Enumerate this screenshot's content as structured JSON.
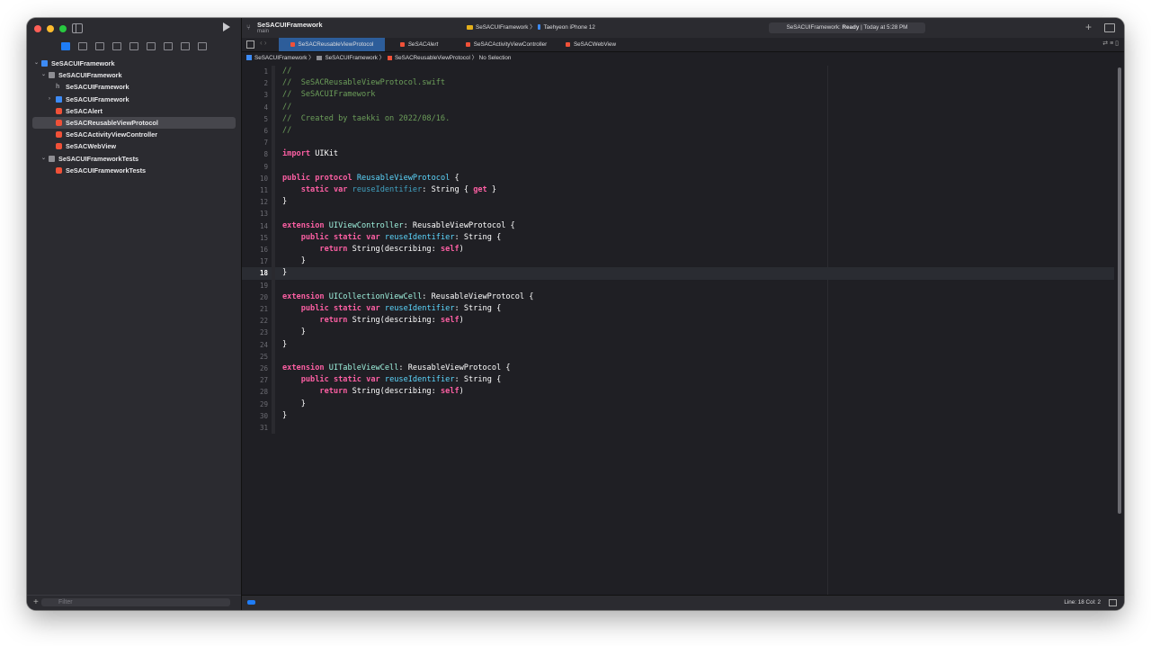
{
  "window": {
    "project_name": "SeSACUIFramework",
    "branch": "main"
  },
  "toolbar": {
    "scheme_target": "SeSACUIFramework",
    "scheme_device": "Taehyeon iPhone 12",
    "status_project": "SeSACUIFramework: ",
    "status_state": "Ready",
    "status_time": " | Today at 5:28 PM"
  },
  "navigator": {
    "items": [
      {
        "label": "SeSACUIFramework",
        "indent": 0,
        "icon": "proj",
        "chev": "⌄"
      },
      {
        "label": "SeSACUIFramework",
        "indent": 1,
        "icon": "folder",
        "chev": "⌄"
      },
      {
        "label": "SeSACUIFramework",
        "indent": 2,
        "icon": "hfile",
        "chev": ""
      },
      {
        "label": "SeSACUIFramework",
        "indent": 2,
        "icon": "proj",
        "chev": "›"
      },
      {
        "label": "SeSACAlert",
        "indent": 2,
        "icon": "swift",
        "chev": ""
      },
      {
        "label": "SeSACReusableViewProtocol",
        "indent": 2,
        "icon": "swift",
        "chev": "",
        "selected": true
      },
      {
        "label": "SeSACActivityViewController",
        "indent": 2,
        "icon": "swift",
        "chev": ""
      },
      {
        "label": "SeSACWebView",
        "indent": 2,
        "icon": "swift",
        "chev": ""
      },
      {
        "label": "SeSACUIFrameworkTests",
        "indent": 1,
        "icon": "folder",
        "chev": "⌄"
      },
      {
        "label": "SeSACUIFrameworkTests",
        "indent": 2,
        "icon": "swift",
        "chev": ""
      }
    ],
    "filter_placeholder": "Filter"
  },
  "tabs": [
    {
      "label": "SeSACReusableViewProtocol",
      "active": true
    },
    {
      "label": "SeSACAlert",
      "active": false
    },
    {
      "label": "SeSACActivityViewController",
      "active": false
    },
    {
      "label": "SeSACWebView",
      "active": false
    }
  ],
  "breadcrumb": {
    "project": "SeSACUIFramework",
    "folder": "SeSACUIFramework",
    "file": "SeSACReusableViewProtocol",
    "selection": "No Selection"
  },
  "editor": {
    "current_line": 18,
    "lines": [
      [
        [
          "c-cm",
          "//"
        ]
      ],
      [
        [
          "c-cm",
          "//  SeSACReusableViewProtocol.swift"
        ]
      ],
      [
        [
          "c-cm",
          "//  SeSACUIFramework"
        ]
      ],
      [
        [
          "c-cm",
          "//"
        ]
      ],
      [
        [
          "c-cm",
          "//  Created by taekki on 2022/08/16."
        ]
      ],
      [
        [
          "c-cm",
          "//"
        ]
      ],
      [],
      [
        [
          "c-kw",
          "import"
        ],
        [
          "c-pl",
          " UIKit"
        ]
      ],
      [],
      [
        [
          "c-kw",
          "public"
        ],
        [
          "c-pl",
          " "
        ],
        [
          "c-kw",
          "protocol"
        ],
        [
          "c-pl",
          " "
        ],
        [
          "c-ty",
          "ReusableViewProtocol"
        ],
        [
          "c-pl",
          " {"
        ]
      ],
      [
        [
          "c-pl",
          "    "
        ],
        [
          "c-kw",
          "static"
        ],
        [
          "c-pl",
          " "
        ],
        [
          "c-kw",
          "var"
        ],
        [
          "c-pl",
          " "
        ],
        [
          "c-id",
          "reuseIdentifier"
        ],
        [
          "c-pl",
          ": String { "
        ],
        [
          "c-kw",
          "get"
        ],
        [
          "c-pl",
          " }"
        ]
      ],
      [
        [
          "c-pl",
          "}"
        ]
      ],
      [],
      [
        [
          "c-kw",
          "extension"
        ],
        [
          "c-pl",
          " "
        ],
        [
          "c-ty2",
          "UIViewController"
        ],
        [
          "c-pl",
          ": ReusableViewProtocol {"
        ]
      ],
      [
        [
          "c-pl",
          "    "
        ],
        [
          "c-kw",
          "public"
        ],
        [
          "c-pl",
          " "
        ],
        [
          "c-kw",
          "static"
        ],
        [
          "c-pl",
          " "
        ],
        [
          "c-kw",
          "var"
        ],
        [
          "c-pl",
          " "
        ],
        [
          "c-ty",
          "reuseIdentifier"
        ],
        [
          "c-pl",
          ": String {"
        ]
      ],
      [
        [
          "c-pl",
          "        "
        ],
        [
          "c-kw",
          "return"
        ],
        [
          "c-pl",
          " String(describing: "
        ],
        [
          "c-kw",
          "self"
        ],
        [
          "c-pl",
          ")"
        ]
      ],
      [
        [
          "c-pl",
          "    }"
        ]
      ],
      [
        [
          "c-pl",
          "}"
        ]
      ],
      [],
      [
        [
          "c-kw",
          "extension"
        ],
        [
          "c-pl",
          " "
        ],
        [
          "c-ty2",
          "UICollectionViewCell"
        ],
        [
          "c-pl",
          ": ReusableViewProtocol {"
        ]
      ],
      [
        [
          "c-pl",
          "    "
        ],
        [
          "c-kw",
          "public"
        ],
        [
          "c-pl",
          " "
        ],
        [
          "c-kw",
          "static"
        ],
        [
          "c-pl",
          " "
        ],
        [
          "c-kw",
          "var"
        ],
        [
          "c-pl",
          " "
        ],
        [
          "c-ty",
          "reuseIdentifier"
        ],
        [
          "c-pl",
          ": String {"
        ]
      ],
      [
        [
          "c-pl",
          "        "
        ],
        [
          "c-kw",
          "return"
        ],
        [
          "c-pl",
          " String(describing: "
        ],
        [
          "c-kw",
          "self"
        ],
        [
          "c-pl",
          ")"
        ]
      ],
      [
        [
          "c-pl",
          "    }"
        ]
      ],
      [
        [
          "c-pl",
          "}"
        ]
      ],
      [],
      [
        [
          "c-kw",
          "extension"
        ],
        [
          "c-pl",
          " "
        ],
        [
          "c-ty2",
          "UITableViewCell"
        ],
        [
          "c-pl",
          ": ReusableViewProtocol {"
        ]
      ],
      [
        [
          "c-pl",
          "    "
        ],
        [
          "c-kw",
          "public"
        ],
        [
          "c-pl",
          " "
        ],
        [
          "c-kw",
          "static"
        ],
        [
          "c-pl",
          " "
        ],
        [
          "c-kw",
          "var"
        ],
        [
          "c-pl",
          " "
        ],
        [
          "c-ty",
          "reuseIdentifier"
        ],
        [
          "c-pl",
          ": String {"
        ]
      ],
      [
        [
          "c-pl",
          "        "
        ],
        [
          "c-kw",
          "return"
        ],
        [
          "c-pl",
          " String(describing: "
        ],
        [
          "c-kw",
          "self"
        ],
        [
          "c-pl",
          ")"
        ]
      ],
      [
        [
          "c-pl",
          "    }"
        ]
      ],
      [
        [
          "c-pl",
          "}"
        ]
      ],
      []
    ]
  },
  "statusbar": {
    "cursor": "Line: 18  Col: 2"
  },
  "colors": {
    "accent": "#1f7df7",
    "keyword": "#fc5fa3",
    "comment": "#6c9e5a",
    "type": "#5dd8ff"
  }
}
